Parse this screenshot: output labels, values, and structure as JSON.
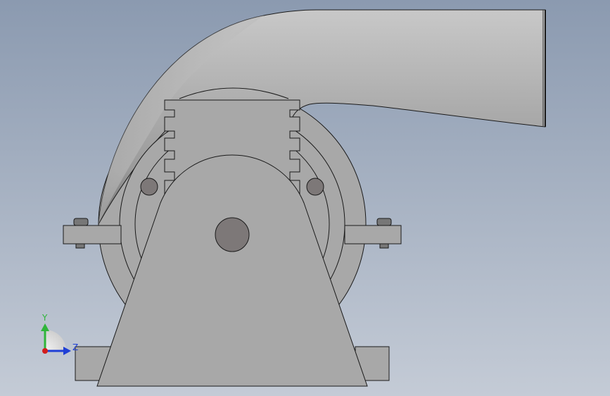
{
  "triad": {
    "y_label": "Y",
    "z_label": "Z",
    "y_color": "#2fb53a",
    "z_color": "#1f3fd6",
    "origin_color": "#d21d1d"
  },
  "colors": {
    "background_top": "#8b9ab0",
    "background_bottom": "#c4cbd6",
    "part_fill": "#a8a8a8",
    "part_dark": "#8a8a8a",
    "hole_fill": "#7d7878",
    "edge": "#1a1a1a"
  }
}
